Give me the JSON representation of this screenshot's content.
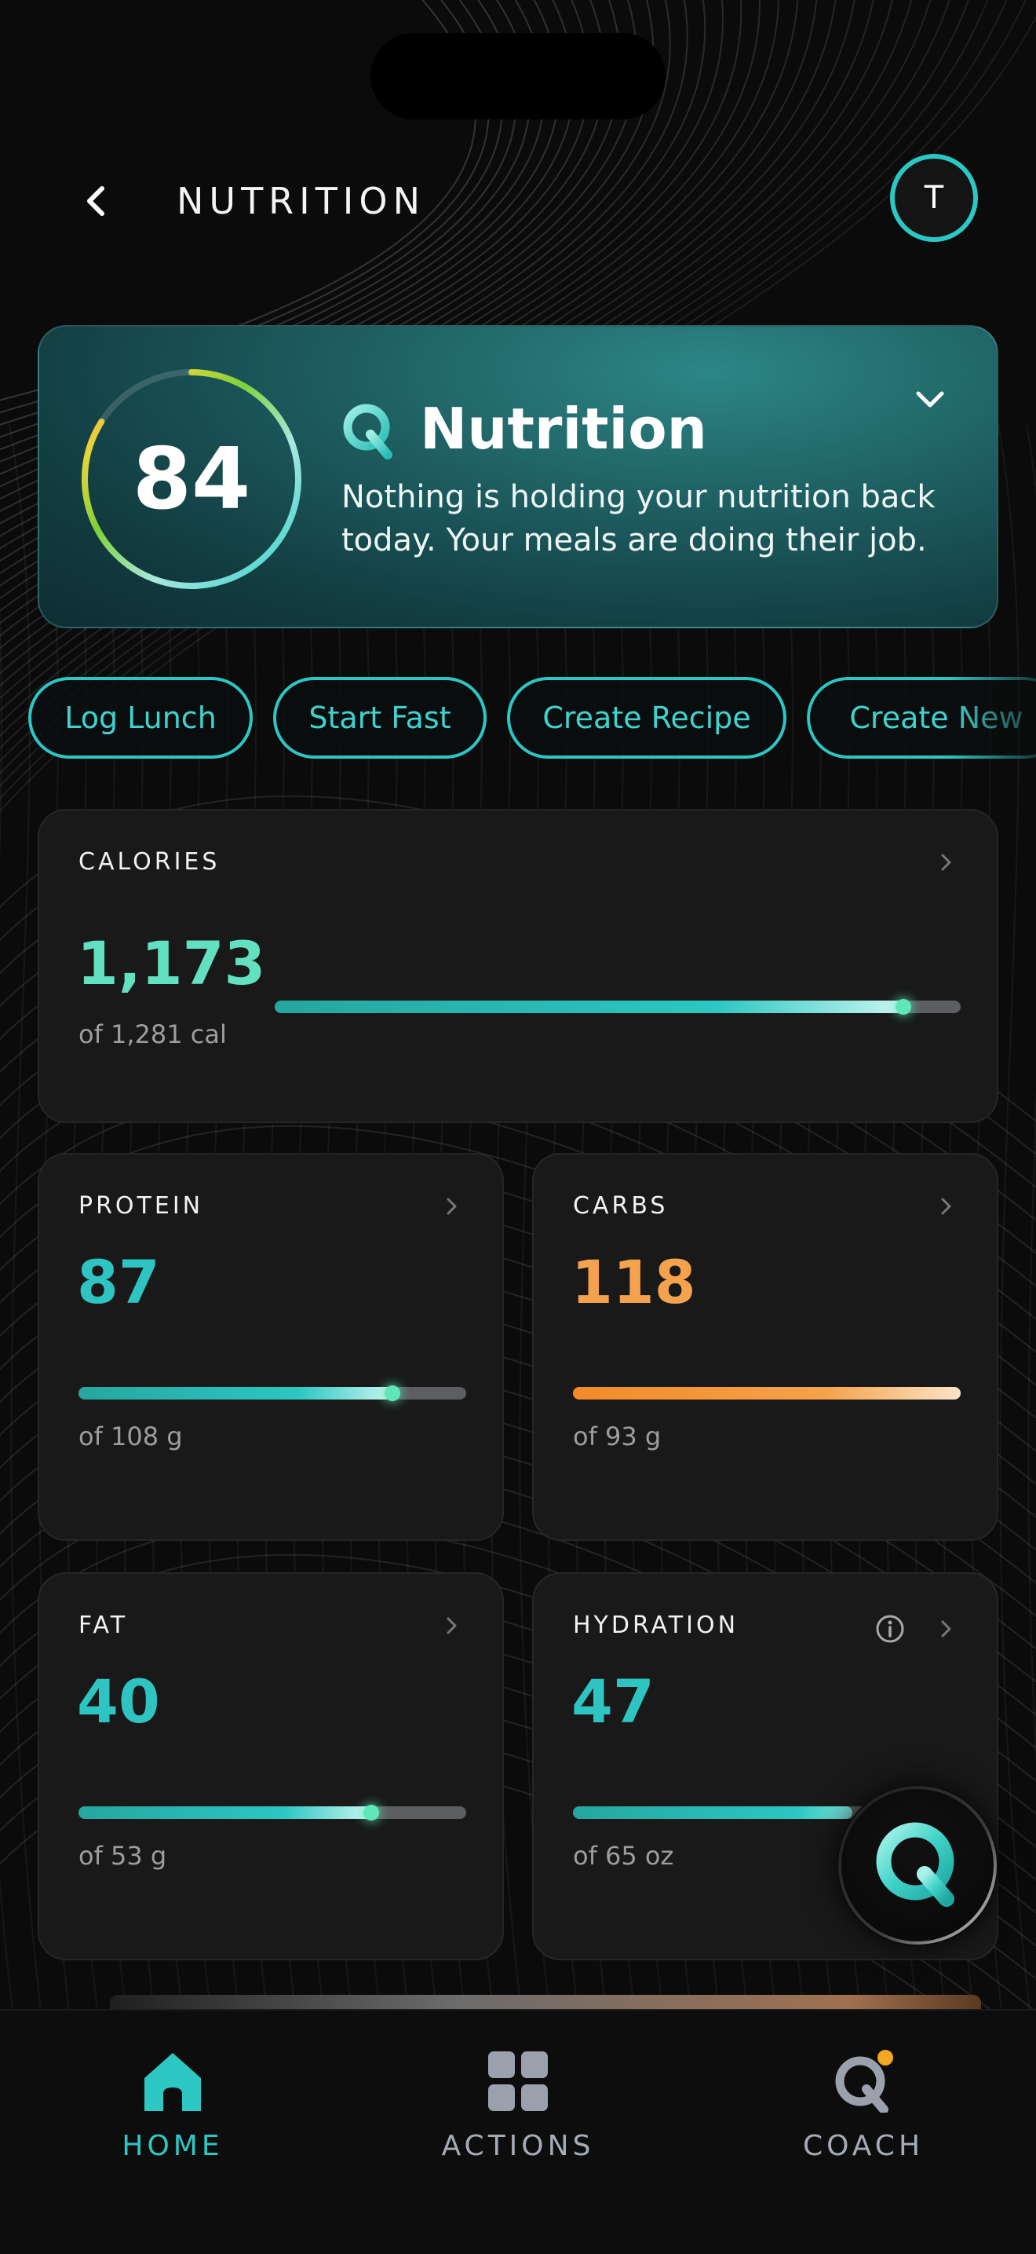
{
  "header": {
    "title": "NUTRITION",
    "avatar_initial": "T"
  },
  "hero": {
    "score": "84",
    "score_fraction": 0.84,
    "title": "Nutrition",
    "description": "Nothing is holding your nutrition back today. Your meals are doing their job."
  },
  "chips": [
    "Log Lunch",
    "Start Fast",
    "Create Recipe",
    "Create New"
  ],
  "cards": {
    "calories": {
      "label": "CALORIES",
      "value": "1,173",
      "target": "of 1,281 cal",
      "progress": 0.916
    },
    "protein": {
      "label": "PROTEIN",
      "value": "87",
      "target": "of 108 g",
      "progress": 0.81
    },
    "carbs": {
      "label": "CARBS",
      "value": "118",
      "target": "of 93 g",
      "progress": 1.0
    },
    "fat": {
      "label": "FAT",
      "value": "40",
      "target": "of 53 g",
      "progress": 0.755
    },
    "hydration": {
      "label": "HYDRATION",
      "value": "47",
      "target": "of 65 oz",
      "progress": 0.72
    }
  },
  "tabs": [
    {
      "label": "HOME",
      "icon": "home-icon",
      "active": true
    },
    {
      "label": "ACTIONS",
      "icon": "grid-icon",
      "active": false
    },
    {
      "label": "COACH",
      "icon": "q-coach-icon",
      "active": false
    }
  ],
  "colors": {
    "accent": "#2bc7c4",
    "calories": "#63e0c0",
    "protein": "#2ec4c2",
    "carbs": "#f4a24e",
    "fat": "#2ec4c2",
    "hydration": "#2ec4c2",
    "notification": "#f5a623"
  }
}
